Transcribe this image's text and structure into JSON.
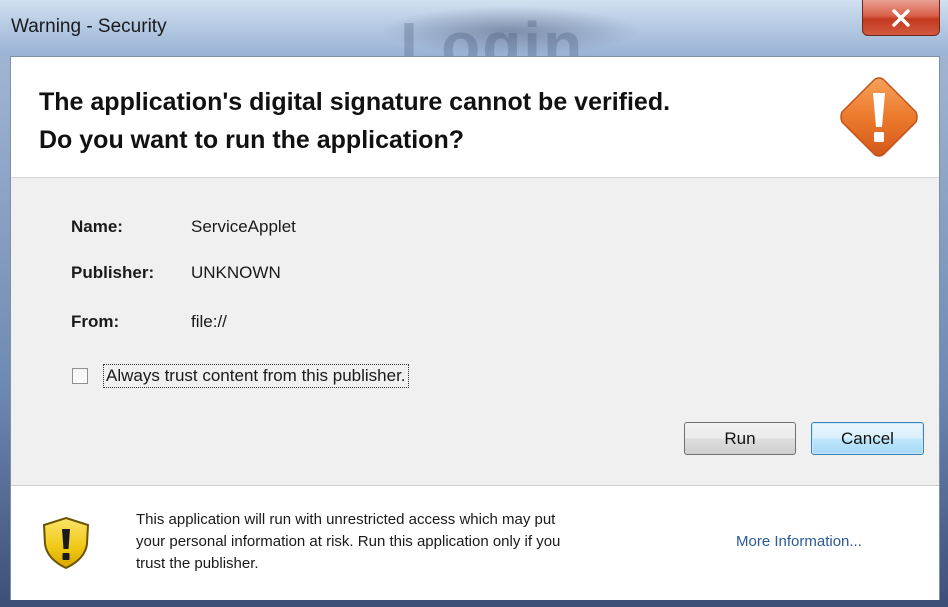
{
  "window": {
    "title": "Warning - Security",
    "background_text": "Login"
  },
  "header": {
    "line1": "The application's digital signature cannot be verified.",
    "line2": "Do you want to run the application?"
  },
  "details": {
    "name_label": "Name:",
    "name_value": "ServiceApplet",
    "publisher_label": "Publisher:",
    "publisher_value": "UNKNOWN",
    "from_label": "From:",
    "from_value": "file://"
  },
  "trust": {
    "label": "Always trust content from this publisher.",
    "checked": false
  },
  "buttons": {
    "run": "Run",
    "cancel": "Cancel"
  },
  "footer": {
    "line1": "This application will run with unrestricted access which may put",
    "line2": "your personal information at risk. Run this application only if you",
    "line3": "trust the publisher.",
    "more_info": "More Information..."
  },
  "icons": {
    "close": "close-icon",
    "warning": "warning-diamond-icon",
    "shield": "shield-warning-icon"
  },
  "colors": {
    "warning_orange": "#e8712a",
    "shield_yellow": "#f3d22a",
    "close_red": "#c8432a",
    "link_blue": "#2a5a9a"
  }
}
